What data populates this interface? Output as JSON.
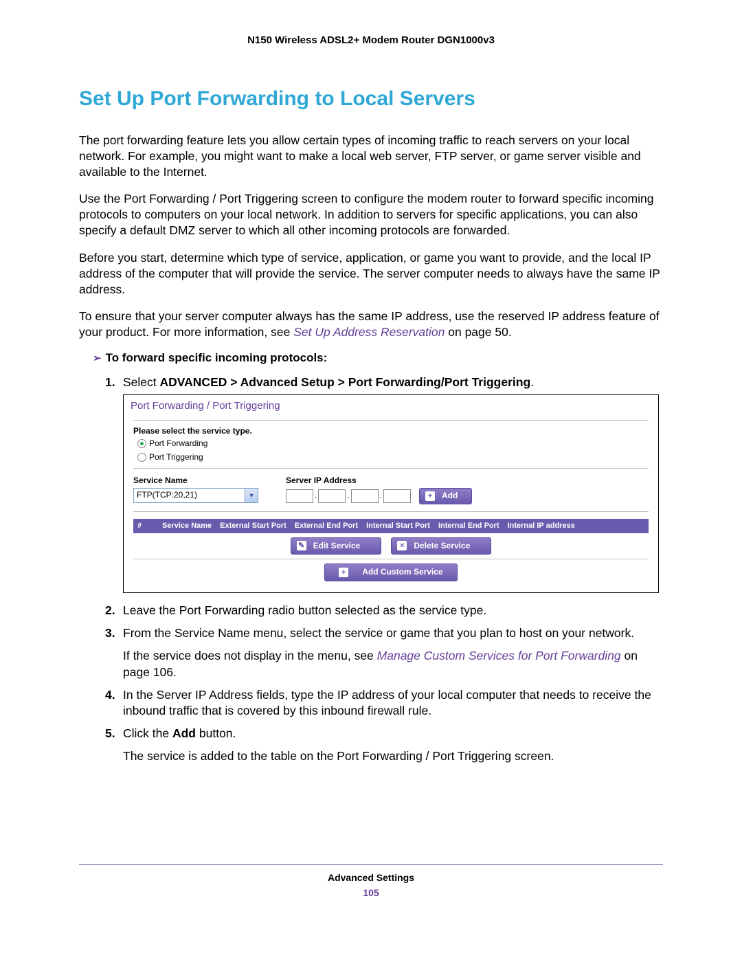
{
  "docHeader": "N150 Wireless ADSL2+ Modem Router DGN1000v3",
  "heading": "Set Up Port Forwarding to Local Servers",
  "para1": "The port forwarding feature lets you allow certain types of incoming traffic to reach servers on your local network. For example, you might want to make a local web server, FTP server, or game server visible and available to the Internet.",
  "para2": "Use the Port Forwarding / Port Triggering screen to configure the modem router to forward specific incoming protocols to computers on your local network. In addition to servers for specific applications, you can also specify a default DMZ server to which all other incoming protocols are forwarded.",
  "para3": "Before you start, determine which type of service, application, or game you want to provide, and the local IP address of the computer that will provide the service. The server computer needs to always have the same IP address.",
  "para4a": "To ensure that your server computer always has the same IP address, use the reserved IP address feature of your product. For more information, see ",
  "para4link": "Set Up Address Reservation",
  "para4b": " on page 50.",
  "procHead": "To forward specific incoming protocols:",
  "steps": {
    "s1a": "Select ",
    "s1bold": "ADVANCED > Advanced Setup > Port Forwarding/Port Triggering",
    "s1b": ".",
    "s2": "Leave the Port Forwarding radio button selected as the service type.",
    "s3a": "From the Service Name menu, select the service or game that you plan to host on your network.",
    "s3b_pre": "If the service does not display in the menu, see ",
    "s3b_link": "Manage Custom Services for Port Forwarding",
    "s3b_post": " on page 106.",
    "s4": "In the Server IP Address fields, type the IP address of your local computer that needs to receive the inbound traffic that is covered by this inbound firewall rule.",
    "s5a": "Click the ",
    "s5bold": "Add",
    "s5b": " button.",
    "s5c": "The service is added to the table on the Port Forwarding / Port Triggering screen."
  },
  "shot": {
    "title": "Port Forwarding / Port Triggering",
    "selectLabel": "Please select the service type.",
    "radio1": "Port Forwarding",
    "radio2": "Port Triggering",
    "snLabel": "Service Name",
    "ipLabel": "Server IP Address",
    "selValue": "FTP(TCP:20,21)",
    "addBtn": "Add",
    "headers": [
      "#",
      "Service Name",
      "External Start Port",
      "External End Port",
      "Internal Start Port",
      "Internal End Port",
      "Internal IP address"
    ],
    "editBtn": "Edit Service",
    "delBtn": "Delete Service",
    "customBtn": "Add Custom Service"
  },
  "footer": {
    "section": "Advanced Settings",
    "page": "105"
  }
}
